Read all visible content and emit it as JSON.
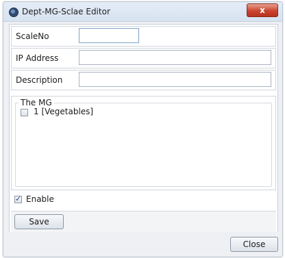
{
  "window": {
    "title": "Dept-MG-Sclae Editor",
    "close_glyph": "x"
  },
  "form": {
    "scale_no": {
      "label": "ScaleNo",
      "value": ""
    },
    "ip_address": {
      "label": "IP Address",
      "value": ""
    },
    "description": {
      "label": "Description",
      "value": ""
    }
  },
  "mg_group": {
    "title": "The MG",
    "items": [
      {
        "label": "1 [Vegetables]",
        "checked": false
      }
    ]
  },
  "enable": {
    "label": "Enable",
    "checked": true
  },
  "buttons": {
    "save_label": "Save",
    "close_label": "Close"
  },
  "colors": {
    "title_bar": "#d7e2f0",
    "close_button": "#c9452f",
    "window_bg": "#eef0f3"
  }
}
